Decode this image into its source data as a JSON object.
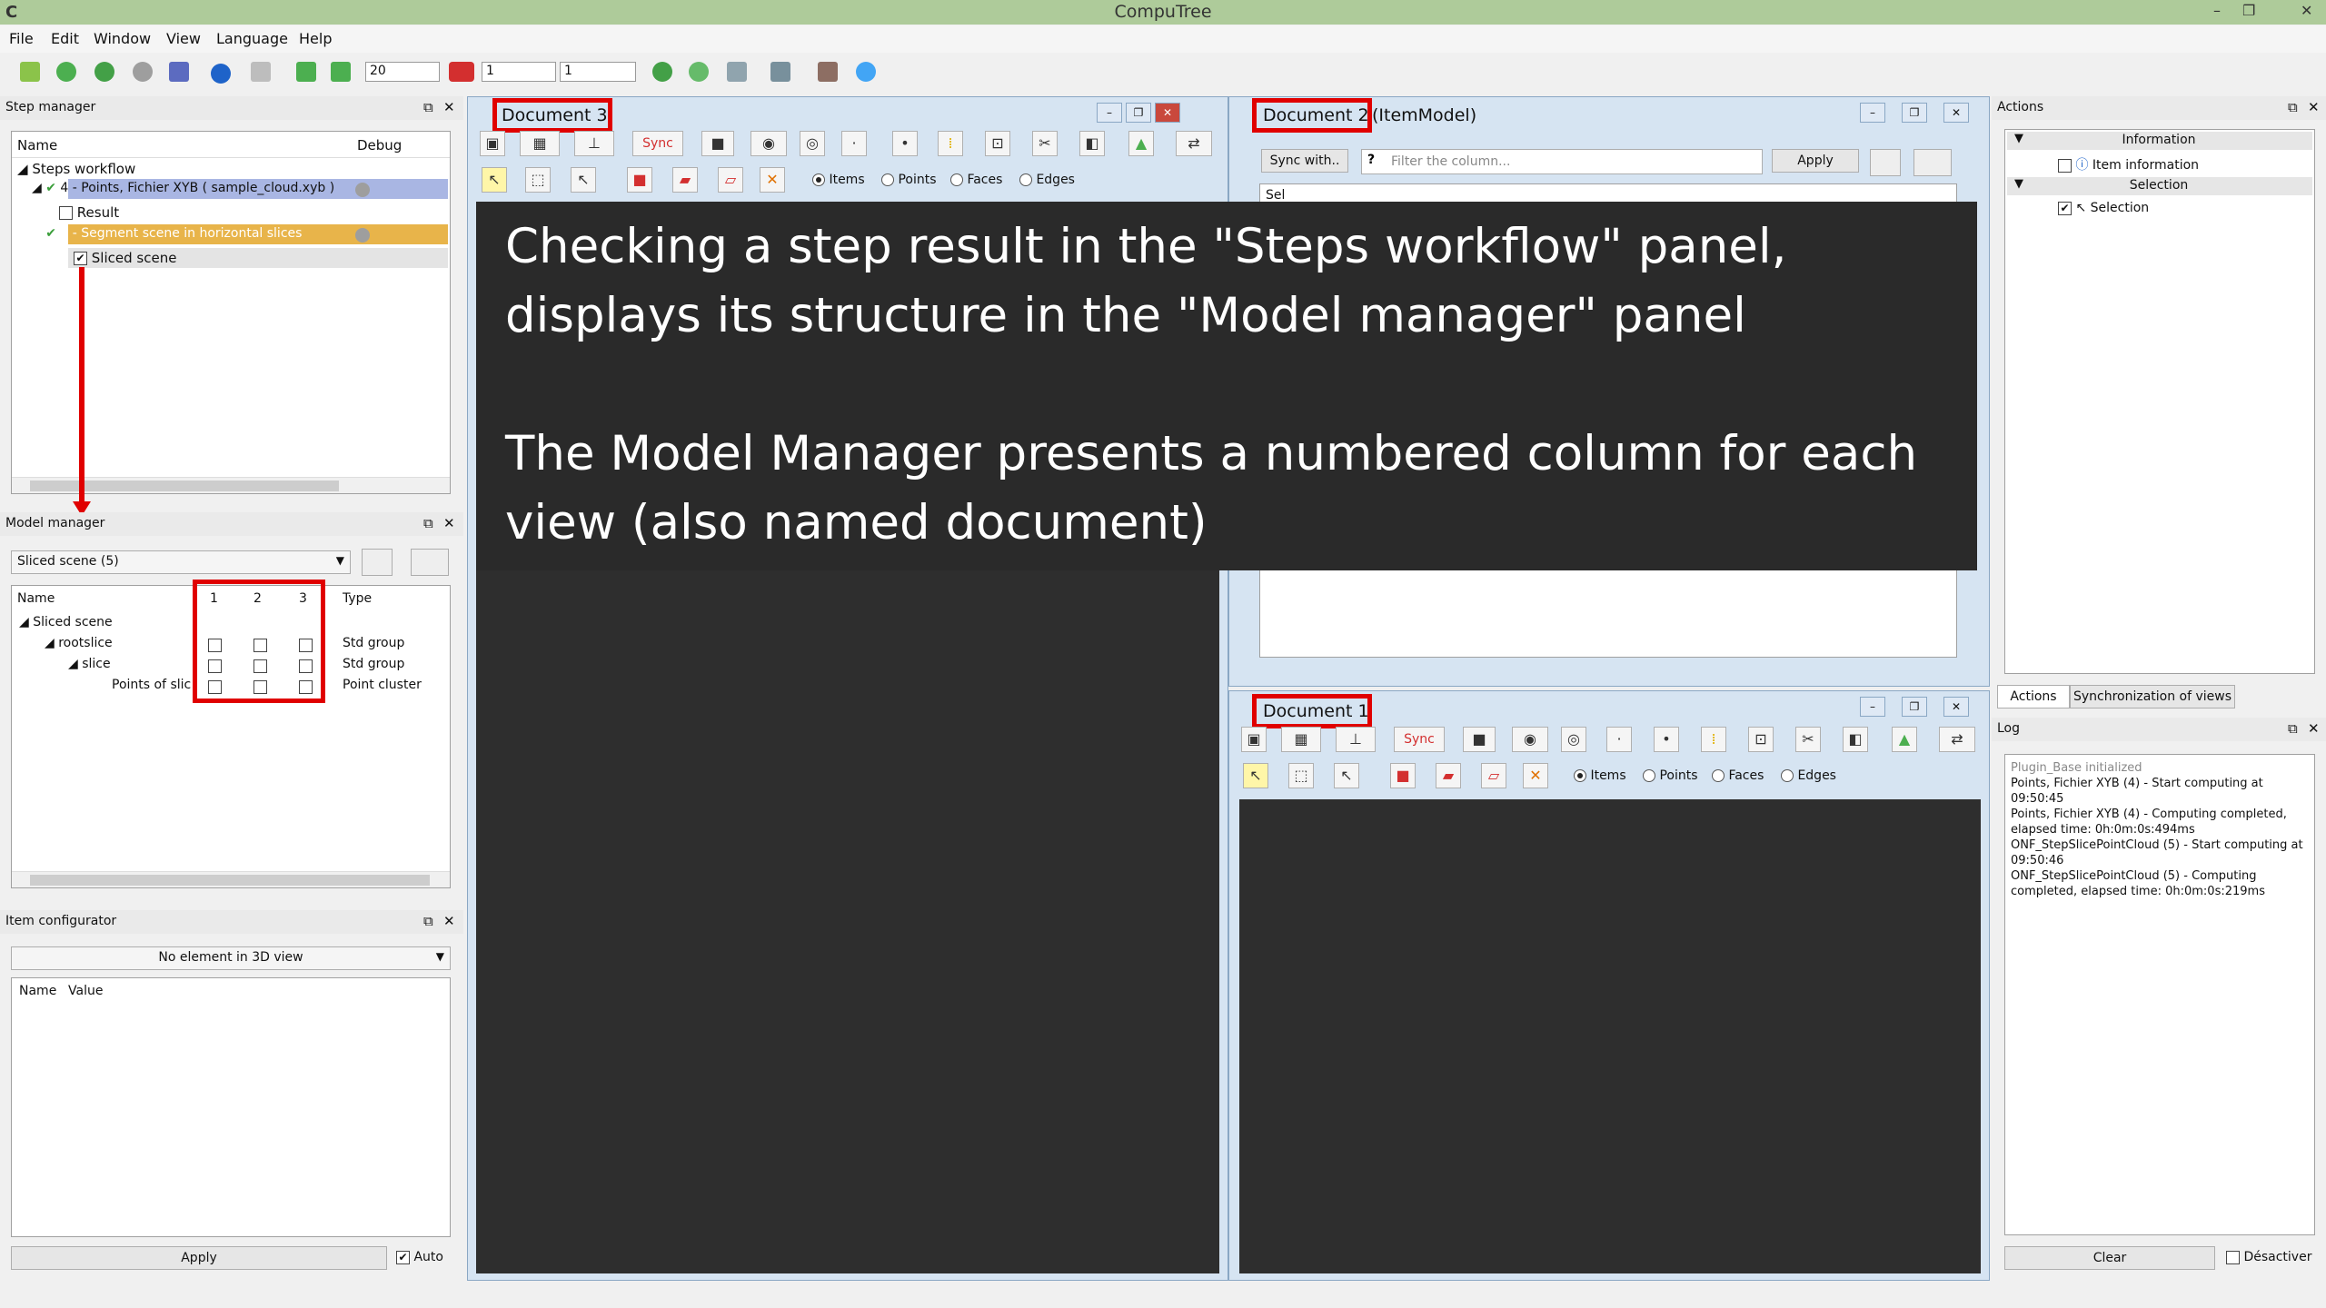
{
  "app": {
    "title": "CompuTree",
    "icon_letter": "C"
  },
  "window_controls": {
    "minimize": "–",
    "restore": "❐",
    "close": "✕"
  },
  "menu": [
    "File",
    "Edit",
    "Window",
    "View",
    "Language",
    "Help"
  ],
  "toolbar": {
    "spin1": "20",
    "spin2": "1",
    "spin3": "1"
  },
  "step_manager": {
    "title": "Step manager",
    "col_name": "Name",
    "col_debug": "Debug",
    "root": "Steps workflow",
    "step4": "4 - Points, Fichier XYB ( sample_cloud.xyb )",
    "result": "Result",
    "step5": "5 - Segment scene in horizontal slices",
    "sliced": "Sliced scene"
  },
  "model_manager": {
    "title": "Model manager",
    "combo": "Sliced scene (5)",
    "col_name": "Name",
    "col1": "1",
    "col2": "2",
    "col3": "3",
    "col_type": "Type",
    "items": [
      {
        "name": "Sliced scene",
        "type": ""
      },
      {
        "name": "rootslice",
        "type": "Std group"
      },
      {
        "name": "slice",
        "type": "Std group"
      },
      {
        "name": "Points of slic",
        "type": "Point cluster"
      }
    ]
  },
  "item_configurator": {
    "title": "Item configurator",
    "combo": "No element in 3D view",
    "col_name": "Name",
    "col_value": "Value",
    "apply": "Apply",
    "auto": "Auto"
  },
  "doc3": {
    "title": "Document 3",
    "sync": "Sync",
    "items": "Items",
    "points": "Points",
    "faces": "Faces",
    "edges": "Edges"
  },
  "doc2": {
    "title": "Document 2",
    "title_suffix": "(ItemModel)",
    "sync_with": "Sync with..",
    "filter_placeholder": "Filter the column...",
    "apply": "Apply",
    "sel": "Sel"
  },
  "doc1": {
    "title": "Document 1",
    "sync": "Sync",
    "items": "Items",
    "points": "Points",
    "faces": "Faces",
    "edges": "Edges"
  },
  "overlay": {
    "line1": "Checking a step result in the \"Steps workflow\" panel, displays its structure in the \"Model manager\" panel",
    "line2": "The Model Manager presents a numbered column for each view (also named document)"
  },
  "actions": {
    "title": "Actions",
    "info_header": "Information",
    "item_info": "Item information",
    "sel_header": "Selection",
    "selection": "Selection",
    "tab1": "Actions",
    "tab2": "Synchronization of views"
  },
  "log": {
    "title": "Log",
    "lines": [
      "Plugin_Base initialized",
      "Points, Fichier XYB (4) - Start computing at",
      "09:50:45",
      "Points, Fichier XYB (4) - Computing completed,",
      "elapsed time: 0h:0m:0s:494ms",
      "ONF_StepSlicePointCloud (5) - Start computing at",
      "09:50:46",
      "ONF_StepSlicePointCloud (5) - Computing",
      "completed, elapsed time: 0h:0m:0s:219ms"
    ],
    "clear": "Clear",
    "desactiver": "Désactiver"
  },
  "colors": {
    "titlebar": "#aecb9a",
    "highlight_blue": "#a9b6e3",
    "highlight_orange": "#e8b44a",
    "red": "#e00000",
    "view_bg": "#2e2e2e"
  }
}
